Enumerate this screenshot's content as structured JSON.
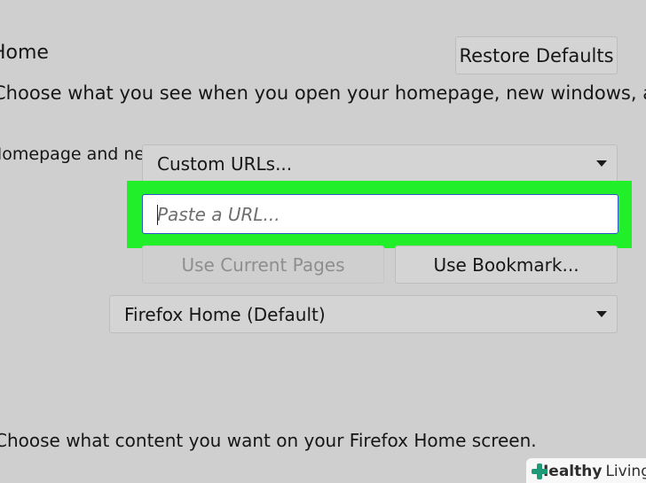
{
  "section": {
    "title": "Home",
    "restore_defaults": "Restore Defaults",
    "description": "Choose what you see when you open your homepage, new windows, and new tabs."
  },
  "homepage": {
    "row_label": "Homepage and new windows",
    "select_value": "Custom URLs...",
    "url_input": {
      "placeholder": "Paste a URL...",
      "value": ""
    },
    "use_current_pages": "Use Current Pages",
    "use_bookmark": "Use Bookmark..."
  },
  "new_tabs": {
    "select_value": "Firefox Home (Default)"
  },
  "firefox_home": {
    "text": "Choose what content you want on your Firefox Home screen."
  },
  "watermark": {
    "brand_a": "Healthy",
    "brand_b": "Living",
    "icon": "medical-cross-icon"
  },
  "colors": {
    "highlight": "#21ef2a",
    "focus_border": "#2c53c9",
    "background": "#cfcfcf"
  }
}
